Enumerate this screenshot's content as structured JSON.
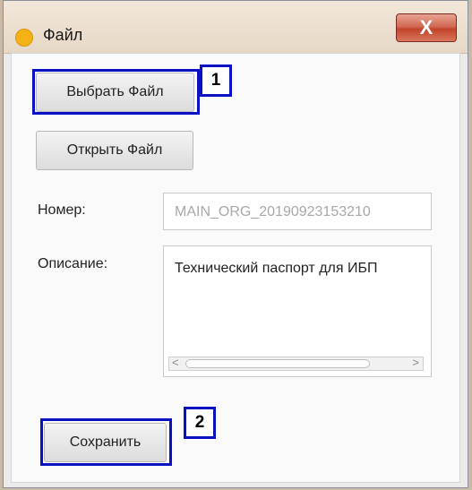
{
  "window": {
    "title": "Файл",
    "close_label": "X"
  },
  "buttons": {
    "select_file": "Выбрать Файл",
    "open_file": "Открыть Файл",
    "save": "Сохранить"
  },
  "form": {
    "number_label": "Номер:",
    "number_value": "MAIN_ORG_20190923153210",
    "description_label": "Описание:",
    "description_value": "Технический паспорт для ИБП"
  },
  "callouts": {
    "first": "1",
    "second": "2"
  },
  "colors": {
    "highlight": "#0a11c4",
    "app_dot": "#f4b215",
    "close_button": "#c1432a"
  }
}
